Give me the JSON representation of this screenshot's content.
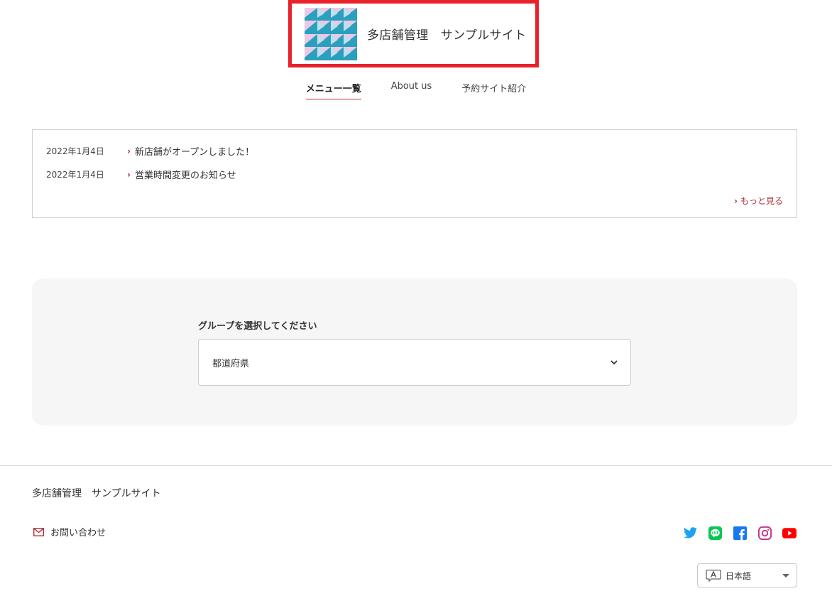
{
  "header": {
    "site_title": "多店舗管理　サンプルサイト"
  },
  "nav": {
    "tabs": [
      {
        "label": "メニュー一覧",
        "active": true
      },
      {
        "label": "About us",
        "active": false
      },
      {
        "label": "予約サイト紹介",
        "active": false
      }
    ]
  },
  "news": {
    "items": [
      {
        "date": "2022年1月4日",
        "title": "新店舗がオープンしました！"
      },
      {
        "date": "2022年1月4日",
        "title": "営業時間変更のお知らせ"
      }
    ],
    "more_label": "もっと見る"
  },
  "group": {
    "label": "グループを選択してください",
    "selected": "都道府県"
  },
  "footer": {
    "site_title": "多店舗管理　サンプルサイト",
    "contact_label": "お問い合わせ",
    "language": "日本語"
  },
  "socials": [
    {
      "name": "twitter-icon",
      "color": "#1da1f2"
    },
    {
      "name": "line-icon",
      "color": "#06c755"
    },
    {
      "name": "facebook-icon",
      "color": "#1877f2"
    },
    {
      "name": "instagram-icon",
      "color": "#c13584"
    },
    {
      "name": "youtube-icon",
      "color": "#ff0000"
    }
  ],
  "colors": {
    "accent": "#e8212b",
    "link_red": "#b0303a",
    "panel_bg": "#f6f6f6"
  }
}
